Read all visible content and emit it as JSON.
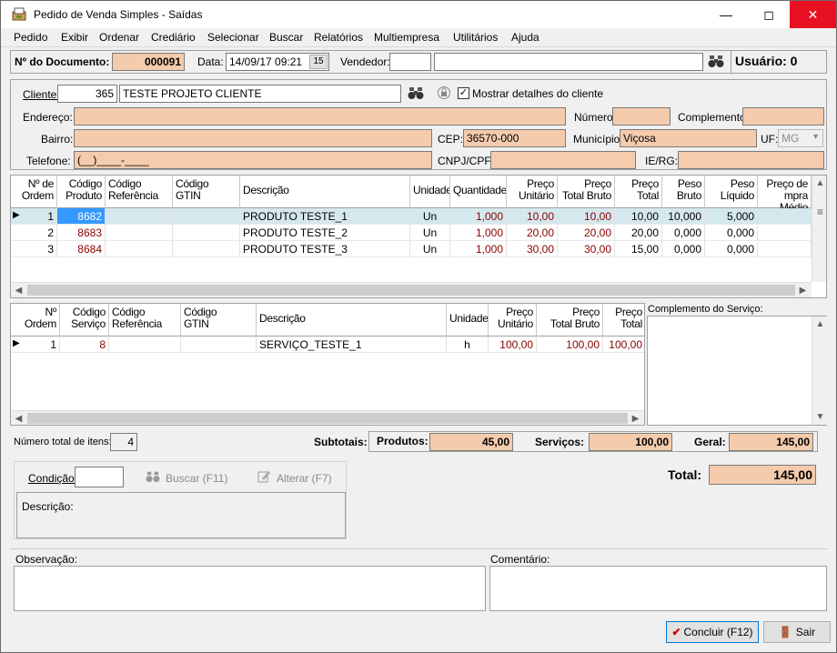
{
  "window": {
    "title": "Pedido de Venda Simples - Saídas",
    "min": "—",
    "max": "◻",
    "close": "✕"
  },
  "menu": [
    "Pedido",
    "Exibir",
    "Ordenar",
    "Crediário",
    "Selecionar",
    "Buscar",
    "Relatórios",
    "Multiempresa",
    "Utilitários",
    "Ajuda"
  ],
  "header": {
    "doc_label": "Nº do Documento:",
    "doc_value": "000091",
    "data_label": "Data:",
    "data_value": "14/09/17 09:21",
    "calendar_label": "15",
    "vendedor_label": "Vendedor:",
    "vendedor_code": "",
    "vendedor_name": "",
    "usuario_label": "Usuário: 0"
  },
  "cliente": {
    "label": "Cliente:",
    "code": "365",
    "name": "TESTE PROJETO CLIENTE",
    "mostrar_label": "Mostrar detalhes do cliente",
    "mostrar_checked": true,
    "endereco_label": "Endereço:",
    "endereco": "",
    "numero_label": "Número:",
    "numero": "",
    "complemento_label": "Complemento:",
    "complemento": "",
    "bairro_label": "Bairro:",
    "bairro": "",
    "cep_label": "CEP:",
    "cep": "36570-000",
    "municipio_label": "Município:",
    "municipio": "Viçosa",
    "uf_label": "UF:",
    "uf": "MG",
    "telefone_label": "Telefone:",
    "telefone": "(__)____-____",
    "cnpj_label": "CNPJ/CPF:",
    "cnpj": "",
    "ie_label": "IE/RG:",
    "ie": ""
  },
  "produtos": {
    "columns": [
      "Nº de\nOrdem",
      "Código\nProduto",
      "Código\nReferência",
      "Código\nGTIN",
      "Descrição",
      "Unidade",
      "Quantidade",
      "Preço\nUnitário",
      "Preço\nTotal Bruto",
      "Preço\nTotal",
      "Peso\nBruto",
      "Peso\nLíquido",
      "Preço de\nmpra Médio"
    ],
    "rows": [
      {
        "ordem": "1",
        "codigo": "8682",
        "ref": "",
        "gtin": "",
        "desc": "PRODUTO TESTE_1",
        "un": "Un",
        "qtd": "1,000",
        "unit": "10,00",
        "bruto": "10,00",
        "total": "10,00",
        "pbruto": "10,000",
        "pliq": "5,000",
        "medio": ""
      },
      {
        "ordem": "2",
        "codigo": "8683",
        "ref": "",
        "gtin": "",
        "desc": "PRODUTO TESTE_2",
        "un": "Un",
        "qtd": "1,000",
        "unit": "20,00",
        "bruto": "20,00",
        "total": "20,00",
        "pbruto": "0,000",
        "pliq": "0,000",
        "medio": ""
      },
      {
        "ordem": "3",
        "codigo": "8684",
        "ref": "",
        "gtin": "",
        "desc": "PRODUTO TESTE_3",
        "un": "Un",
        "qtd": "1,000",
        "unit": "30,00",
        "bruto": "30,00",
        "total": "15,00",
        "pbruto": "0,000",
        "pliq": "0,000",
        "medio": ""
      }
    ]
  },
  "servicos": {
    "columns": [
      "Nº\nOrdem",
      "Código\nServiço",
      "Código\nReferência",
      "Código\nGTIN",
      "Descrição",
      "Unidade",
      "Preço\nUnitário",
      "Preço\nTotal Bruto",
      "Preço\nTotal"
    ],
    "rows": [
      {
        "ordem": "1",
        "codigo": "8",
        "ref": "",
        "gtin": "",
        "desc": "SERVIÇO_TESTE_1",
        "un": "h",
        "unit": "100,00",
        "bruto": "100,00",
        "total": "100,00"
      }
    ],
    "complemento_label": "Complemento do Serviço:"
  },
  "totais": {
    "num_itens_label": "Número total de itens:",
    "num_itens": "4",
    "subtotais_label": "Subtotais:",
    "produtos_label": "Produtos:",
    "produtos": "45,00",
    "servicos_label": "Serviços:",
    "servicos": "100,00",
    "geral_label": "Geral:",
    "geral": "145,00",
    "total_label": "Total:",
    "total": "145,00"
  },
  "condicao": {
    "label": "Condição:",
    "value": "",
    "buscar": "Buscar (F11)",
    "alterar": "Alterar (F7)",
    "descricao_label": "Descrição:"
  },
  "obs": {
    "observacao_label": "Observação:",
    "comentario_label": "Comentário:"
  },
  "footer": {
    "concluir": "Concluir (F12)",
    "sair": "Sair"
  },
  "colors": {
    "salmon": "#f4cbac",
    "selected_row": "#d5e8ee",
    "highlight": "#3399ff",
    "code_red": "#8b0000"
  }
}
